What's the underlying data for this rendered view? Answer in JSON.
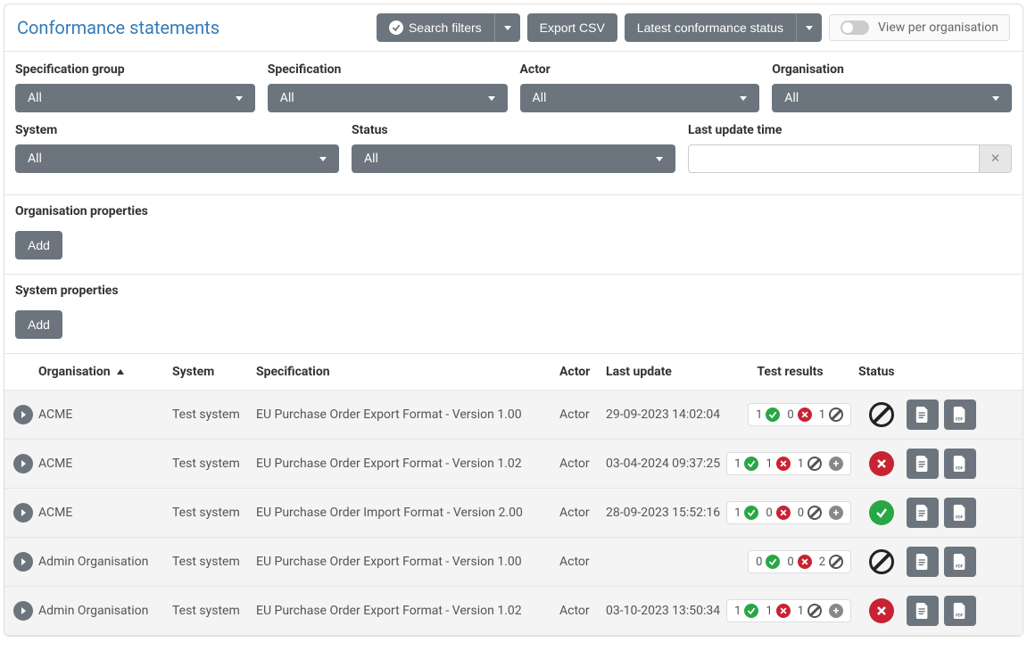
{
  "page": {
    "title": "Conformance statements"
  },
  "header": {
    "search_filters": "Search filters",
    "export_csv": "Export CSV",
    "latest_status": "Latest conformance status",
    "view_per_org": "View per organisation"
  },
  "filters": {
    "row1": [
      {
        "label": "Specification group",
        "value": "All"
      },
      {
        "label": "Specification",
        "value": "All"
      },
      {
        "label": "Actor",
        "value": "All"
      },
      {
        "label": "Organisation",
        "value": "All"
      }
    ],
    "row2": {
      "system": {
        "label": "System",
        "value": "All"
      },
      "status": {
        "label": "Status",
        "value": "All"
      },
      "last_update": {
        "label": "Last update time",
        "value": ""
      }
    }
  },
  "org_props": {
    "label": "Organisation properties",
    "add": "Add"
  },
  "sys_props": {
    "label": "System properties",
    "add": "Add"
  },
  "table": {
    "headers": {
      "organisation": "Organisation",
      "system": "System",
      "specification": "Specification",
      "actor": "Actor",
      "last_update": "Last update",
      "test_results": "Test results",
      "status": "Status"
    },
    "rows": [
      {
        "organisation": "ACME",
        "system": "Test system",
        "specification": "EU Purchase Order Export Format - Version 1.00",
        "actor": "Actor",
        "last_update": "29-09-2023 14:02:04",
        "results": {
          "pass": 1,
          "fail": 0,
          "none": 1,
          "plus": false
        },
        "status": "none"
      },
      {
        "organisation": "ACME",
        "system": "Test system",
        "specification": "EU Purchase Order Export Format - Version 1.02",
        "actor": "Actor",
        "last_update": "03-04-2024 09:37:25",
        "results": {
          "pass": 1,
          "fail": 1,
          "none": 1,
          "plus": true
        },
        "status": "fail"
      },
      {
        "organisation": "ACME",
        "system": "Test system",
        "specification": "EU Purchase Order Import Format - Version 2.00",
        "actor": "Actor",
        "last_update": "28-09-2023 15:52:16",
        "results": {
          "pass": 1,
          "fail": 0,
          "none": 0,
          "plus": true
        },
        "status": "pass"
      },
      {
        "organisation": "Admin Organisation",
        "system": "Test system",
        "specification": "EU Purchase Order Export Format - Version 1.00",
        "actor": "Actor",
        "last_update": "",
        "results": {
          "pass": 0,
          "fail": 0,
          "none": 2,
          "plus": false
        },
        "status": "none"
      },
      {
        "organisation": "Admin Organisation",
        "system": "Test system",
        "specification": "EU Purchase Order Export Format - Version 1.02",
        "actor": "Actor",
        "last_update": "03-10-2023 13:50:34",
        "results": {
          "pass": 1,
          "fail": 1,
          "none": 1,
          "plus": true
        },
        "status": "fail"
      }
    ]
  }
}
